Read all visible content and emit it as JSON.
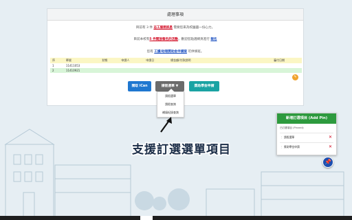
{
  "panel": {
    "title": "處理事項",
    "msg1_pre": "目前有 3 件 ",
    "msg1_link": "志工服務訊息",
    "msg1_post": " 需要您來為校園盡一份心力。",
    "msg2_pre": "目前本校有",
    "msg2_link": "5 件開放報名的活動",
    "msg2_mid": "，歡迎您點選網頁進行 ",
    "msg2_link2": "報名",
    "msg3_pre": "您有 ",
    "msg3_link": "工讀/助理獎助金申請案",
    "msg3_post": " 可供填寫。"
  },
  "table": {
    "headers": [
      "序",
      "單號",
      "狀態",
      "申請人",
      "申請日",
      "總金額/付款說明",
      "",
      "",
      "",
      "",
      "",
      "",
      "",
      "",
      "審付日期"
    ],
    "rows": [
      {
        "seq": "1",
        "id": "11411053"
      },
      {
        "seq": "2",
        "id": "11410921"
      }
    ]
  },
  "buttons": {
    "ican": "閱取 iCan",
    "subscribe": "請假選單 ▼",
    "grant": "獎助學金申請"
  },
  "dropdown": {
    "items": [
      "請假選單",
      "請假查詢",
      "補填紀錄查詢"
    ]
  },
  "caption": "支援訂選選單項目",
  "favorites": {
    "title": "新增訂選項目 (Add Pin)",
    "subtitle": "已訂選項目 (Pinned):",
    "items": [
      "請假選單",
      "獎助學金申請"
    ]
  },
  "colors": {
    "accent_green": "#2d9a3e",
    "button_blue": "#1f77d0",
    "button_teal": "#1aa3a3",
    "link_red": "#d0021b"
  },
  "icons": {
    "pin": "pin-icon",
    "remove": "close-icon",
    "pointer": "arrow-icon"
  }
}
